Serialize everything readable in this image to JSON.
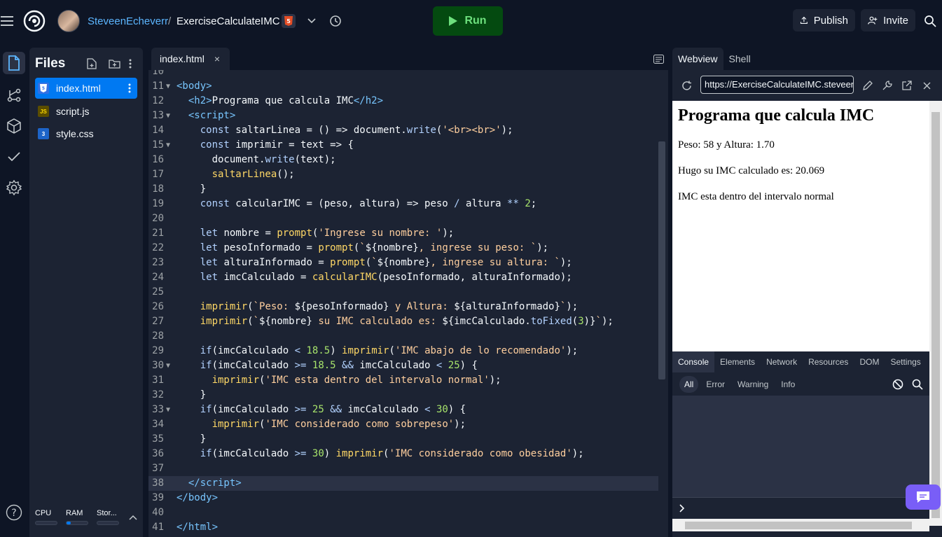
{
  "topbar": {
    "username": "SteveenEcheverr",
    "separator": "/",
    "repl_name": "ExerciseCalculateIMC",
    "run_label": "Run",
    "publish_label": "Publish",
    "invite_label": "Invite"
  },
  "files_panel": {
    "title": "Files",
    "files": [
      {
        "name": "index.html",
        "type": "html",
        "badge": "5"
      },
      {
        "name": "script.js",
        "type": "js",
        "badge": "JS"
      },
      {
        "name": "style.css",
        "type": "css",
        "badge": "3"
      }
    ]
  },
  "editor": {
    "tab_label": "index.html",
    "close_glyph": "×"
  },
  "status": {
    "cpu": "CPU",
    "ram": "RAM",
    "storage": "Stor..."
  },
  "preview": {
    "tabs": [
      "Webview",
      "Shell"
    ],
    "url": "https://ExerciseCalculateIMC.steveene",
    "heading": "Programa que calcula IMC",
    "lines": [
      "Peso: 58 y Altura: 1.70",
      "Hugo su IMC calculado es: 20.069",
      "IMC esta dentro del intervalo normal"
    ]
  },
  "console": {
    "tabs": [
      "Console",
      "Elements",
      "Network",
      "Resources",
      "DOM",
      "Settings"
    ],
    "filters": [
      "All",
      "Error",
      "Warning",
      "Info"
    ]
  },
  "colors": {
    "accent": "#0079f2",
    "run_bg": "#044a10",
    "run_fg": "#6de07d",
    "chat": "#795ef7"
  }
}
